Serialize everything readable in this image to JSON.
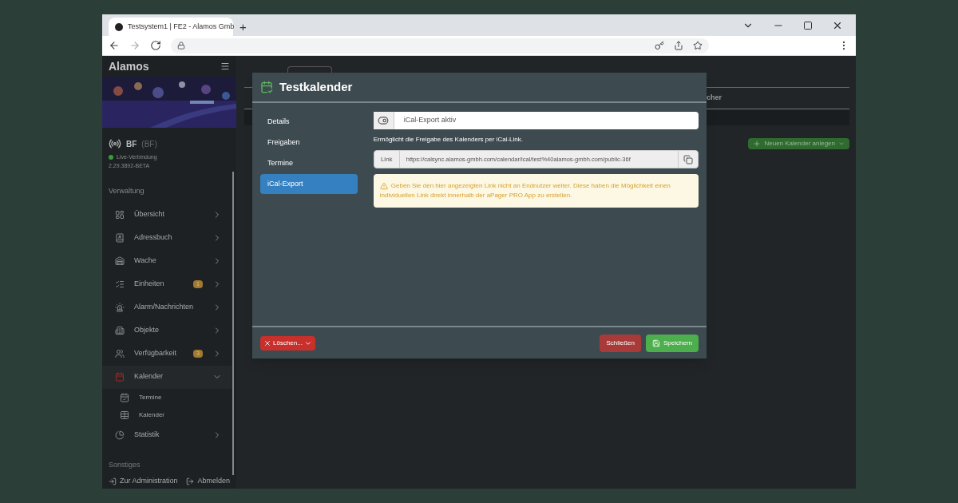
{
  "browser": {
    "tab_title": "Testsystem1 | FE2 - Alamos Gmb",
    "new_tab": "+"
  },
  "sidebar": {
    "logo": "Alamos",
    "unit": "BF",
    "unit_code": "(BF)",
    "connection": "Live-Verbindung",
    "connected": true,
    "version": "2.29.3892-BETA",
    "section": "Verwaltung",
    "items": [
      {
        "label": "Übersicht",
        "selected": false,
        "expanded": false
      },
      {
        "label": "Adressbuch",
        "selected": false,
        "expanded": false
      },
      {
        "label": "Wache",
        "selected": false,
        "expanded": false
      },
      {
        "label": "Einheiten",
        "badge": "1",
        "selected": false,
        "expanded": false
      },
      {
        "label": "Alarm/Nachrichten",
        "selected": false,
        "expanded": false
      },
      {
        "label": "Objekte",
        "selected": false,
        "expanded": false
      },
      {
        "label": "Verfügbarkeit",
        "badge": "3",
        "selected": false,
        "expanded": false
      },
      {
        "label": "Kalender",
        "selected": true,
        "expanded": true,
        "children": [
          {
            "label": "Termine"
          },
          {
            "label": "Kalender"
          }
        ]
      },
      {
        "label": "Statistik",
        "selected": false,
        "expanded": false
      }
    ],
    "section_2": "Sonstiges",
    "footer": [
      "Zur Administration",
      "Abmelden"
    ]
  },
  "background": {
    "column_3": "cher",
    "new_button": "Neuen Kalender anlegen"
  },
  "modal": {
    "title": "Testkalender",
    "tabs": [
      {
        "label": "Details",
        "selected": false
      },
      {
        "label": "Freigaben",
        "selected": false
      },
      {
        "label": "Termine",
        "selected": false
      },
      {
        "label": "iCal-Export",
        "selected": true
      }
    ],
    "toggle": {
      "label": "iCal-Export aktiv",
      "on": true
    },
    "help": "Ermöglicht die Freigabe des Kalenders per iCal-Link.",
    "link_label": "Link",
    "link": "https://calsync.alamos-gmbh.com/calendar/ical/test%40alamos-gmbh.com/public-36f",
    "warning": "Geben Sie den hier angezeigten Link nicht an Endnutzer weiter. Diese haben die Möglichkeit einen individuellen Link direkt innerhalb der aPager PRO App zu erstellen.",
    "delete": "Löschen...",
    "close": "Schließen",
    "save": "Speichern"
  }
}
